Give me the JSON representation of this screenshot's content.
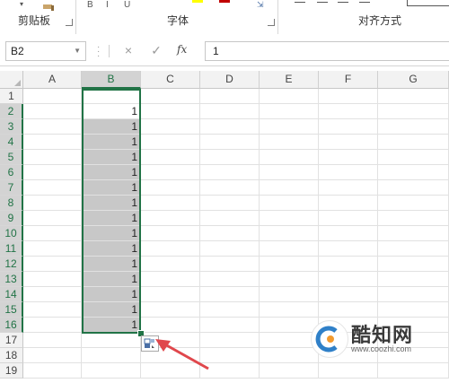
{
  "ribbon": {
    "groups": [
      {
        "label": "剪贴板"
      },
      {
        "label": "字体"
      },
      {
        "label": "对齐方式"
      }
    ]
  },
  "formula_bar": {
    "name_box": "B2",
    "cancel_icon": "×",
    "enter_icon": "✓",
    "fx_label": "fx",
    "value": "1"
  },
  "sheet": {
    "columns": [
      "A",
      "B",
      "C",
      "D",
      "E",
      "F",
      "G"
    ],
    "rows": [
      "1",
      "2",
      "3",
      "4",
      "5",
      "6",
      "7",
      "8",
      "9",
      "10",
      "11",
      "12",
      "13",
      "14",
      "15",
      "16",
      "17",
      "18",
      "19"
    ],
    "selected_column": "B",
    "selected_rows": [
      "2",
      "3",
      "4",
      "5",
      "6",
      "7",
      "8",
      "9",
      "10",
      "11",
      "12",
      "13",
      "14",
      "15",
      "16"
    ],
    "active_cell": "B2",
    "b_values": [
      "",
      "1",
      "1",
      "1",
      "1",
      "1",
      "1",
      "1",
      "1",
      "1",
      "1",
      "1",
      "1",
      "1",
      "1",
      "1",
      "",
      "",
      ""
    ]
  },
  "colors": {
    "accent": "#217346",
    "selection_fill": "#c8c8c8",
    "arrow": "#e0474c"
  },
  "watermark": {
    "title": "酷知网",
    "url": "www.coozhi.com"
  }
}
